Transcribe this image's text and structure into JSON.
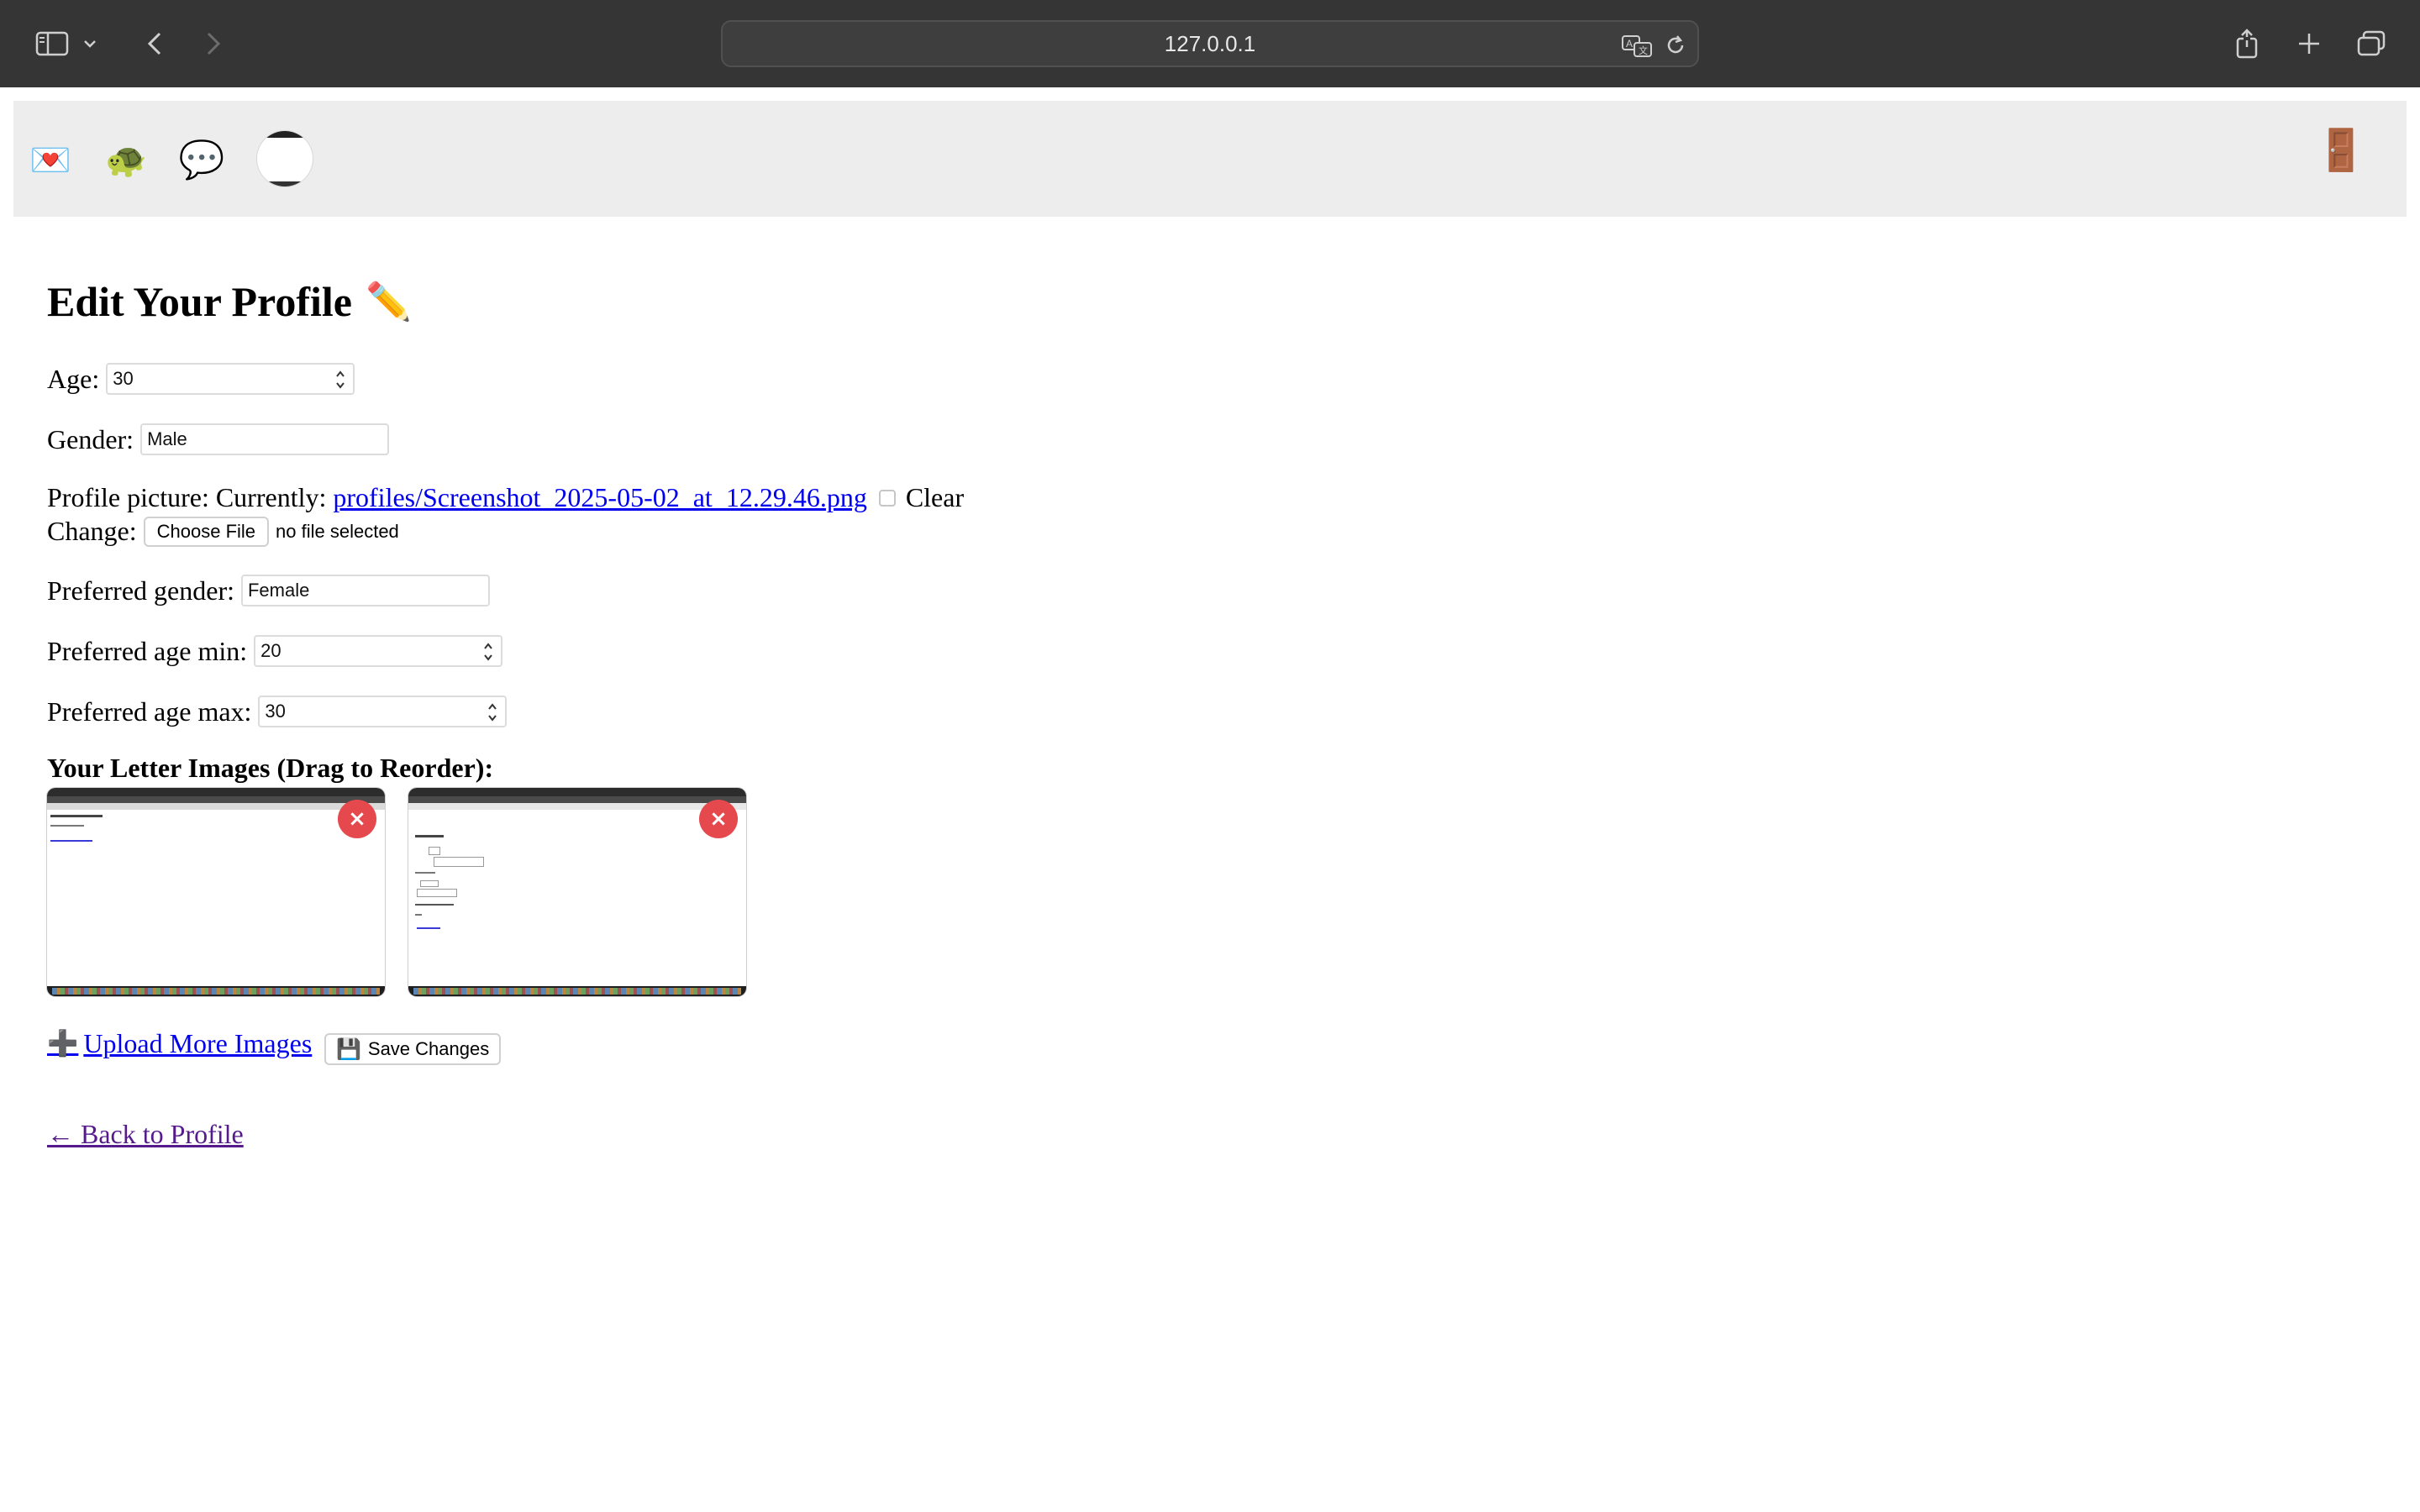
{
  "browser": {
    "url": "127.0.0.1",
    "icons": {
      "sidebar": "sidebar-icon",
      "sidebar_menu": "chevron-down-icon",
      "back": "back-icon",
      "forward": "forward-icon",
      "translate": "translate-icon",
      "reload": "reload-icon",
      "share": "share-icon",
      "new_tab": "plus-icon",
      "tabs": "tabs-overview-icon"
    }
  },
  "nav": {
    "letters_icon": "💌",
    "slow_icon": "🐢",
    "messages_icon": "💬",
    "logout_icon": "🚪"
  },
  "page": {
    "title": "Edit Your Profile",
    "title_icon": "✏️",
    "age": {
      "label": "Age:",
      "value": "30"
    },
    "gender": {
      "label": "Gender:",
      "value": "Male"
    },
    "profile_picture": {
      "label": "Profile picture:",
      "currently_label": "Currently:",
      "current_file": "profiles/Screenshot_2025-05-02_at_12.29.46.png",
      "clear_label": "Clear",
      "change_label": "Change:",
      "choose_button": "Choose File",
      "file_status": "no file selected"
    },
    "preferred_gender": {
      "label": "Preferred gender:",
      "value": "Female"
    },
    "preferred_age_min": {
      "label": "Preferred age min:",
      "value": "20"
    },
    "preferred_age_max": {
      "label": "Preferred age max:",
      "value": "30"
    },
    "letter_images_heading": "Your Letter Images (Drag to Reorder):",
    "letter_images": [
      {
        "delete_label": "×"
      },
      {
        "delete_label": "×"
      }
    ],
    "upload_icon": "➕",
    "upload_label": "Upload More Images",
    "save_icon": "💾",
    "save_label": "Save Changes",
    "back_label": "← Back to Profile"
  },
  "colors": {
    "chrome_bg": "#353535",
    "nav_bg": "#ededed",
    "link": "#0000ee",
    "visited_link": "#551a8b",
    "delete_button": "#e5484d"
  }
}
